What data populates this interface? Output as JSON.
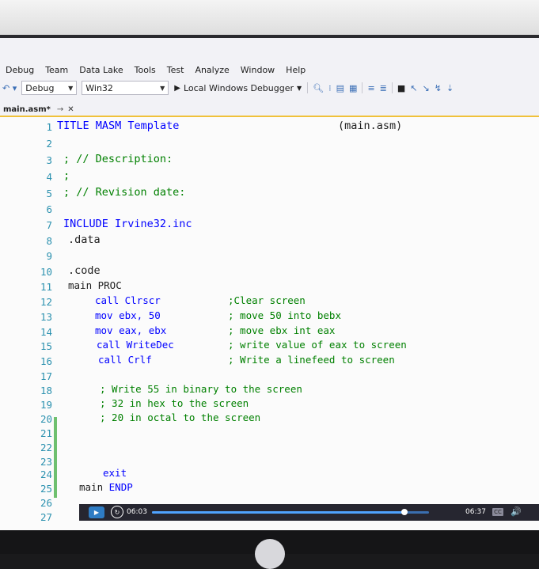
{
  "menu": [
    "Debug",
    "Team",
    "Data Lake",
    "Tools",
    "Test",
    "Analyze",
    "Window",
    "Help"
  ],
  "toolbar": {
    "nav_icons": "↶ ▾",
    "config": "Debug",
    "platform": "Win32",
    "run_label": "Local Windows Debugger"
  },
  "tab": {
    "title": "main.asm*",
    "pin": "→",
    "close": "✕"
  },
  "editor": {
    "line_numbers": [
      "1",
      "2",
      "3",
      "4",
      "5",
      "6",
      "7",
      "8",
      "9",
      "10",
      "11",
      "12",
      "13",
      "14",
      "15",
      "16",
      "17",
      "18",
      "19",
      "20",
      "21",
      "22",
      "23",
      "24",
      "25",
      "26",
      "27"
    ],
    "lines": {
      "l1": "TITLE MASM Template",
      "l1_right": "(main.asm)",
      "l3": "; // Description:",
      "l4": ";",
      "l5": "; // Revision date:",
      "l7": "INCLUDE Irvine32.inc",
      "l8": ".data",
      "l10": ".code",
      "l11_kw": "main PROC",
      "l12": "call Clrscr",
      "l12_c": ";Clear screen",
      "l13": "mov ebx, 50",
      "l13_c": "; move 50 into bebx",
      "l14": "mov eax, ebx",
      "l14_c": "; move ebx int eax",
      "l15": "call WriteDec",
      "l15_c": "; write value of eax to screen",
      "l16": "call Crlf",
      "l16_c": "; Write a linefeed to screen",
      "l18_c": "; Write 55 in binary to the screen",
      "l19_c": "; 32 in hex to the screen",
      "l20_c": "; 20 in octal to the screen",
      "l24": "exit",
      "l25_a": "main",
      "l25_b": "ENDP"
    }
  },
  "video": {
    "current_time": "06:03",
    "duration": "06:37",
    "progress": 0.91,
    "cc_label": "CC",
    "volume_icon": "🔊"
  }
}
